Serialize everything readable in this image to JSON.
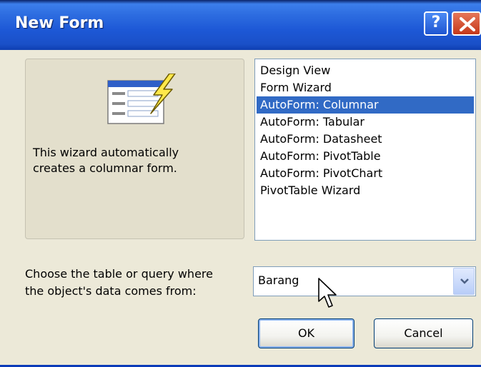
{
  "window": {
    "title": "New Form",
    "help_label": "?"
  },
  "preview": {
    "icon": "form-wizard-icon",
    "description": "This wizard automatically\ncreates a columnar form."
  },
  "list": {
    "items": [
      "Design View",
      "Form Wizard",
      "AutoForm:  Columnar",
      "AutoForm:  Tabular",
      "AutoForm:  Datasheet",
      "AutoForm:  PivotTable",
      "AutoForm:  PivotChart",
      "PivotTable Wizard"
    ],
    "selected": "AutoForm:  Columnar"
  },
  "source": {
    "label": "Choose the table or query where\nthe object's data comes from:",
    "value": "Barang"
  },
  "buttons": {
    "ok": "OK",
    "cancel": "Cancel"
  },
  "colors": {
    "title_bar": "#2D6CE0",
    "selection": "#316AC5",
    "dialog_bg": "#ECE9D8",
    "close_button": "#D9532F"
  }
}
